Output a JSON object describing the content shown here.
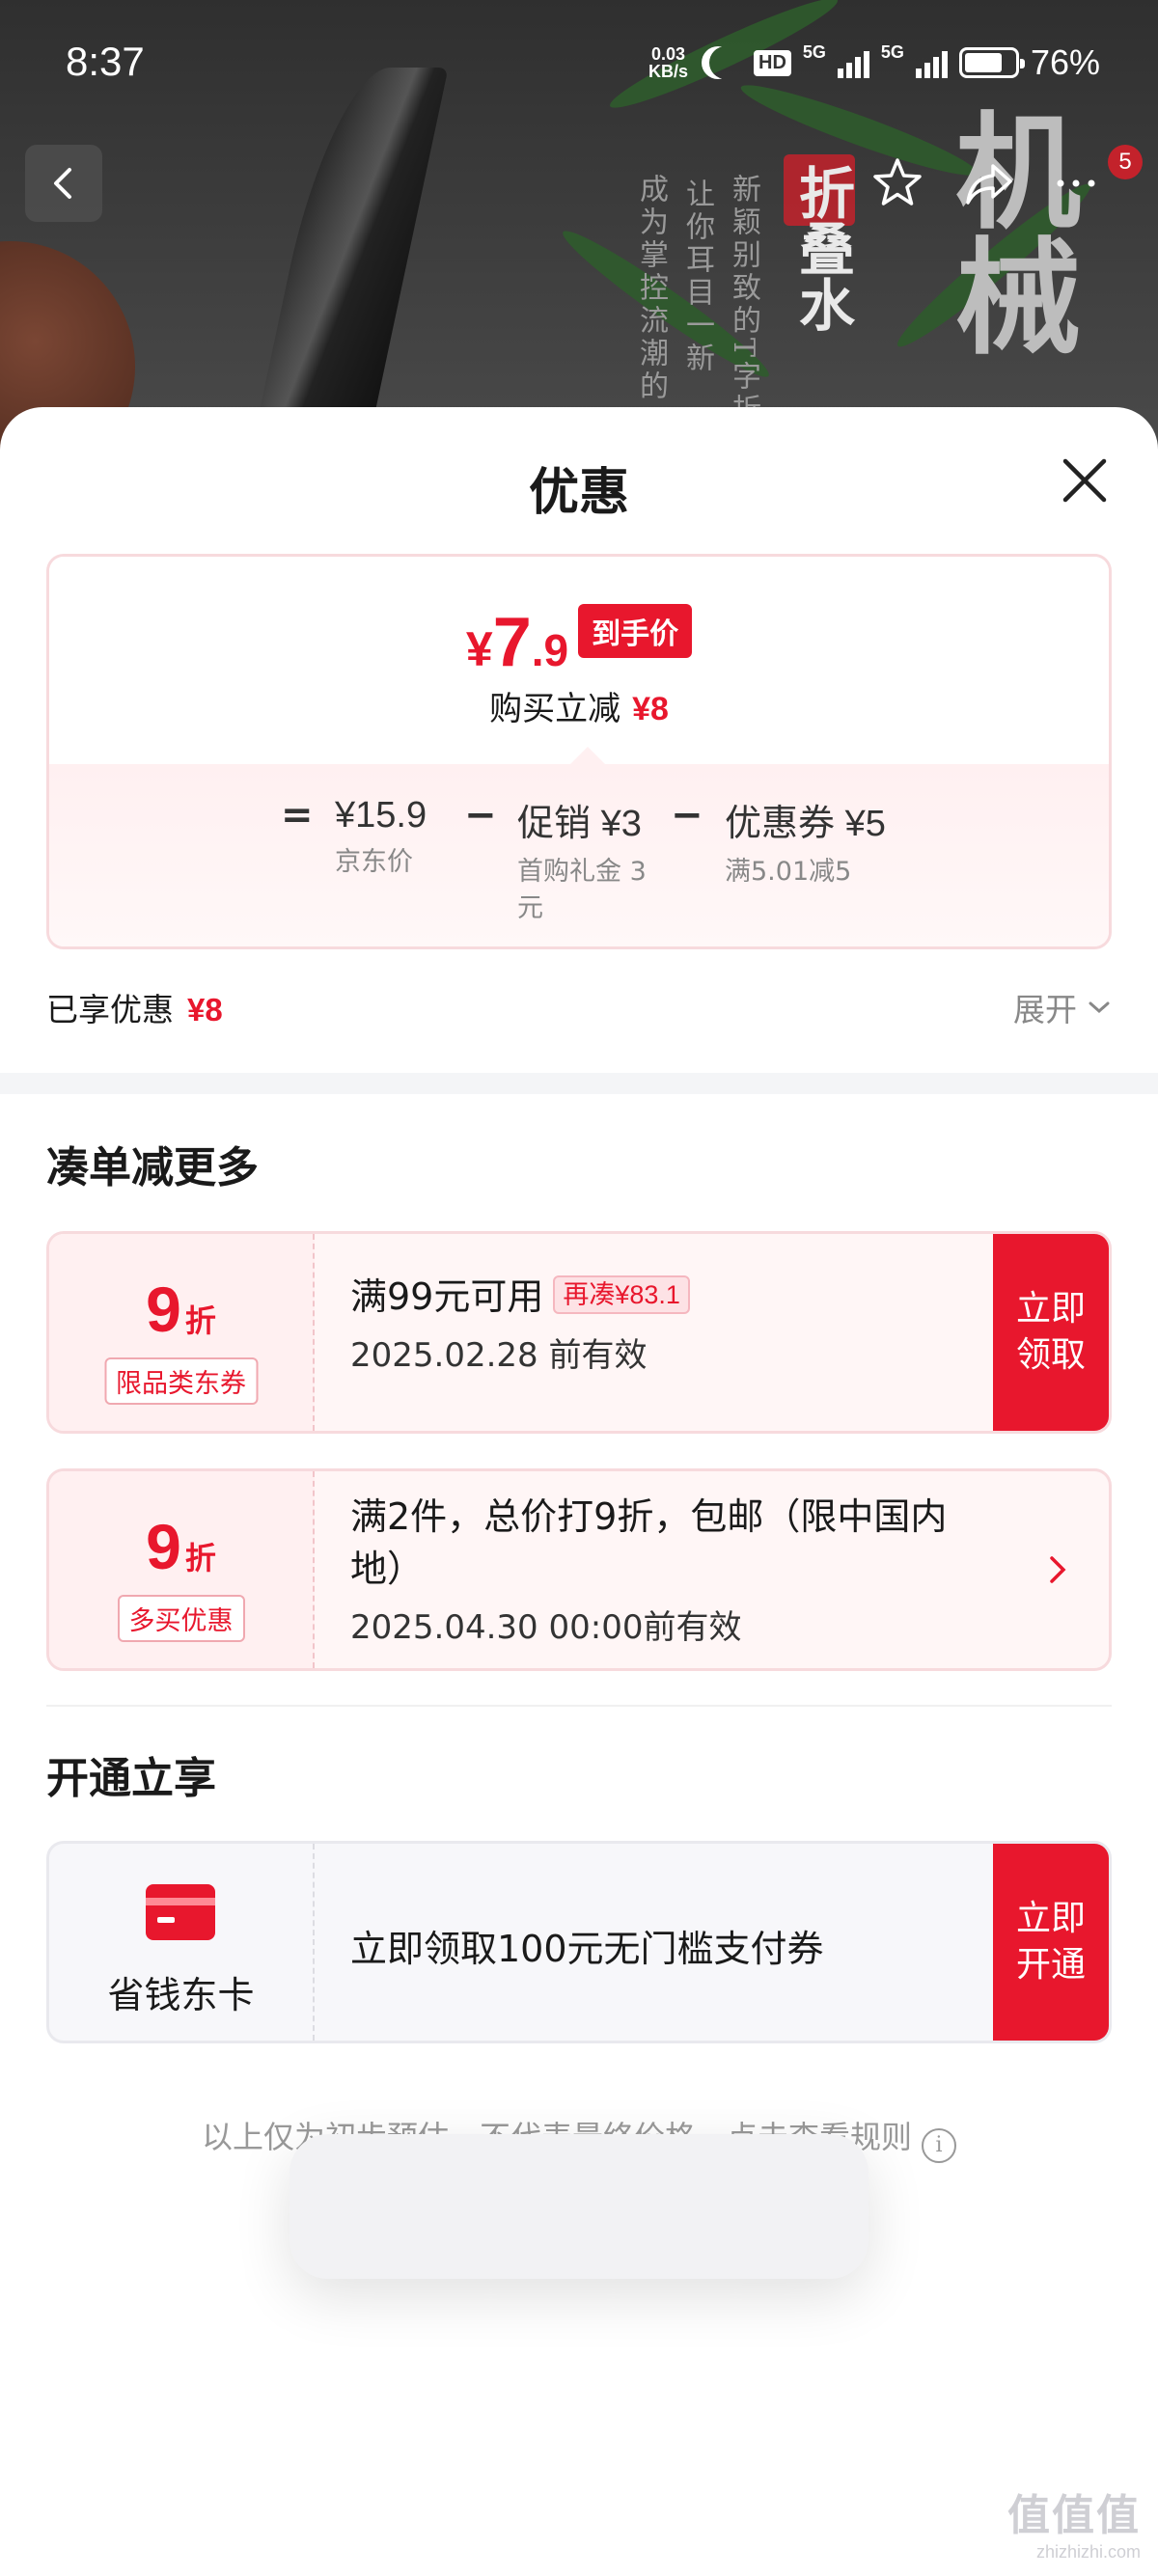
{
  "status_bar": {
    "time": "8:37",
    "net_speed_value": "0.03",
    "net_speed_unit": "KB/s",
    "hd_label": "HD",
    "sim1_label": "5G",
    "sim2_label": "5G",
    "battery": "76%"
  },
  "background": {
    "text_a": "新颖别致的T字折",
    "text_b": "让你耳目一新",
    "text_c": "成为掌控流潮的",
    "text_big": "机械",
    "text_seal": "折叠水",
    "cart_badge": "5"
  },
  "sheet": {
    "title": "优惠"
  },
  "price_card": {
    "currency": "¥",
    "final_int": "7",
    "final_dec": ".9",
    "final_tag": "到手价",
    "reduce_label": "购买立减",
    "reduce_amount": "¥8",
    "equals": "=",
    "minus": "−",
    "items": [
      {
        "value": "¥15.9",
        "label": "",
        "sub": "京东价"
      },
      {
        "value": "¥3",
        "label": "促销",
        "sub": "首购礼金 3元"
      },
      {
        "value": "¥5",
        "label": "优惠券",
        "sub": "满5.01减5"
      }
    ]
  },
  "summary": {
    "enjoyed_label": "已享优惠",
    "enjoyed_amount": "¥8",
    "expand_label": "展开"
  },
  "section_more": {
    "title": "凑单减更多",
    "coupons": [
      {
        "discount": "9",
        "unit": "折",
        "tag": "限品类东券",
        "main": "满99元可用",
        "extra_tag": "再凑¥83.1",
        "date": "2025.02.28 前有效",
        "button": "立即领取"
      },
      {
        "discount": "9",
        "unit": "折",
        "tag": "多买优惠",
        "main": "满2件，总价打9折，包邮（限中国内地）",
        "date": "2025.04.30 00:00前有效"
      }
    ]
  },
  "section_open": {
    "title": "开通立享",
    "card_name": "省钱东卡",
    "text": "立即领取100元无门槛支付券",
    "button": "立即开通"
  },
  "footer": {
    "note": "以上仅为初步预估，不代表最终价格，点击查看规则",
    "info_icon": "i"
  },
  "watermark": {
    "logo": "值值值",
    "url": "zhizhizhi.com"
  },
  "colors": {
    "accent": "#e8172d",
    "tag_bg": "#fff0f1"
  }
}
